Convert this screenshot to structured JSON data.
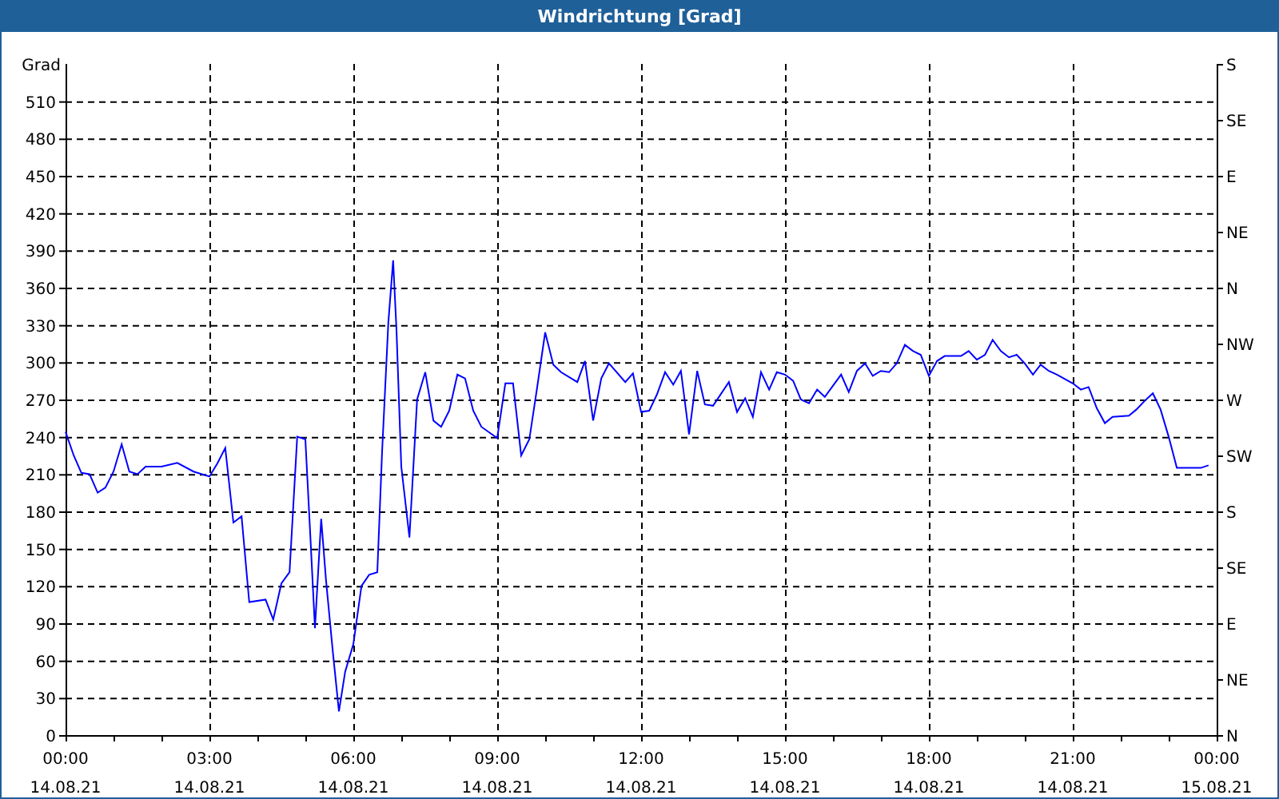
{
  "window": {
    "title": "Windrichtung [Grad]"
  },
  "chart": {
    "chart_data": {
      "type": "line",
      "grid": true,
      "ylabel": "Grad",
      "xlim": [
        0,
        24
      ],
      "ylim": [
        0,
        540
      ],
      "yticks": [
        0,
        30,
        60,
        90,
        120,
        150,
        180,
        210,
        240,
        270,
        300,
        330,
        360,
        390,
        420,
        450,
        480,
        510
      ],
      "xticks": [
        {
          "value": 0,
          "label": "00:00"
        },
        {
          "value": 3,
          "label": "03:00"
        },
        {
          "value": 6,
          "label": "06:00"
        },
        {
          "value": 9,
          "label": "09:00"
        },
        {
          "value": 12,
          "label": "12:00"
        },
        {
          "value": 15,
          "label": "15:00"
        },
        {
          "value": 18,
          "label": "18:00"
        },
        {
          "value": 21,
          "label": "21:00"
        },
        {
          "value": 24,
          "label": "00:00"
        }
      ],
      "x": [
        0,
        0.17,
        0.33,
        0.5,
        0.67,
        0.83,
        1,
        1.17,
        1.33,
        1.5,
        1.67,
        2,
        2.33,
        2.67,
        3,
        3.17,
        3.33,
        3.5,
        3.67,
        3.83,
        4.17,
        4.33,
        4.5,
        4.67,
        4.83,
        5,
        5.1,
        5.2,
        5.33,
        5.43,
        5.57,
        5.7,
        5.83,
        6,
        6.17,
        6.33,
        6.5,
        6.6,
        6.73,
        6.83,
        6.9,
        7,
        7.17,
        7.33,
        7.5,
        7.67,
        7.83,
        8,
        8.17,
        8.33,
        8.5,
        8.67,
        9,
        9.17,
        9.33,
        9.5,
        9.67,
        9.83,
        10,
        10.17,
        10.33,
        10.67,
        10.83,
        11,
        11.17,
        11.33,
        11.67,
        11.83,
        12,
        12.17,
        12.33,
        12.5,
        12.67,
        12.83,
        13,
        13.17,
        13.33,
        13.5,
        13.83,
        14,
        14.17,
        14.33,
        14.5,
        14.67,
        14.83,
        15,
        15.17,
        15.33,
        15.5,
        15.67,
        15.83,
        16.17,
        16.33,
        16.5,
        16.67,
        16.83,
        17,
        17.17,
        17.33,
        17.5,
        17.67,
        17.83,
        18,
        18.17,
        18.33,
        18.67,
        18.83,
        19,
        19.17,
        19.33,
        19.5,
        19.67,
        19.83,
        20,
        20.17,
        20.33,
        20.5,
        20.67,
        21,
        21.17,
        21.33,
        21.5,
        21.67,
        21.83,
        22.17,
        22.33,
        22.5,
        22.67,
        22.83,
        23,
        23.17,
        23.67,
        23.83
      ],
      "series": [
        {
          "color": "#0000ff",
          "values": [
            244,
            225,
            211,
            210,
            195,
            199,
            212,
            234,
            212,
            210,
            216,
            216,
            219,
            212,
            208,
            219,
            231,
            171,
            176,
            107,
            109,
            93,
            122,
            131,
            240,
            238,
            163,
            86,
            174,
            125,
            68,
            19,
            51,
            73,
            120,
            129,
            131,
            228,
            332,
            382,
            326,
            216,
            159,
            270,
            292,
            253,
            248,
            261,
            290,
            287,
            261,
            248,
            239,
            283,
            283,
            225,
            238,
            279,
            324,
            298,
            292,
            284,
            301,
            253,
            287,
            299,
            284,
            291,
            260,
            261,
            274,
            292,
            282,
            293,
            242,
            293,
            266,
            265,
            284,
            260,
            271,
            256,
            292,
            278,
            292,
            290,
            285,
            270,
            267,
            278,
            272,
            290,
            276,
            293,
            299,
            289,
            293,
            292,
            299,
            314,
            309,
            306,
            289,
            301,
            305,
            305,
            309,
            302,
            306,
            318,
            309,
            304,
            306,
            299,
            290,
            298,
            293,
            290,
            283,
            278,
            280,
            263,
            251,
            256,
            257,
            262,
            269,
            275,
            262,
            240,
            215,
            215,
            217
          ]
        }
      ]
    },
    "x_axis_dates": [
      "14.08.21",
      "14.08.21",
      "14.08.21",
      "14.08.21",
      "14.08.21",
      "14.08.21",
      "14.08.21",
      "14.08.21",
      "15.08.21"
    ],
    "right_axis": {
      "ticks": [
        "S",
        "SE",
        "E",
        "NE",
        "N",
        "NW",
        "W",
        "SW",
        "S",
        "SE",
        "E",
        "NE",
        "N"
      ]
    }
  }
}
